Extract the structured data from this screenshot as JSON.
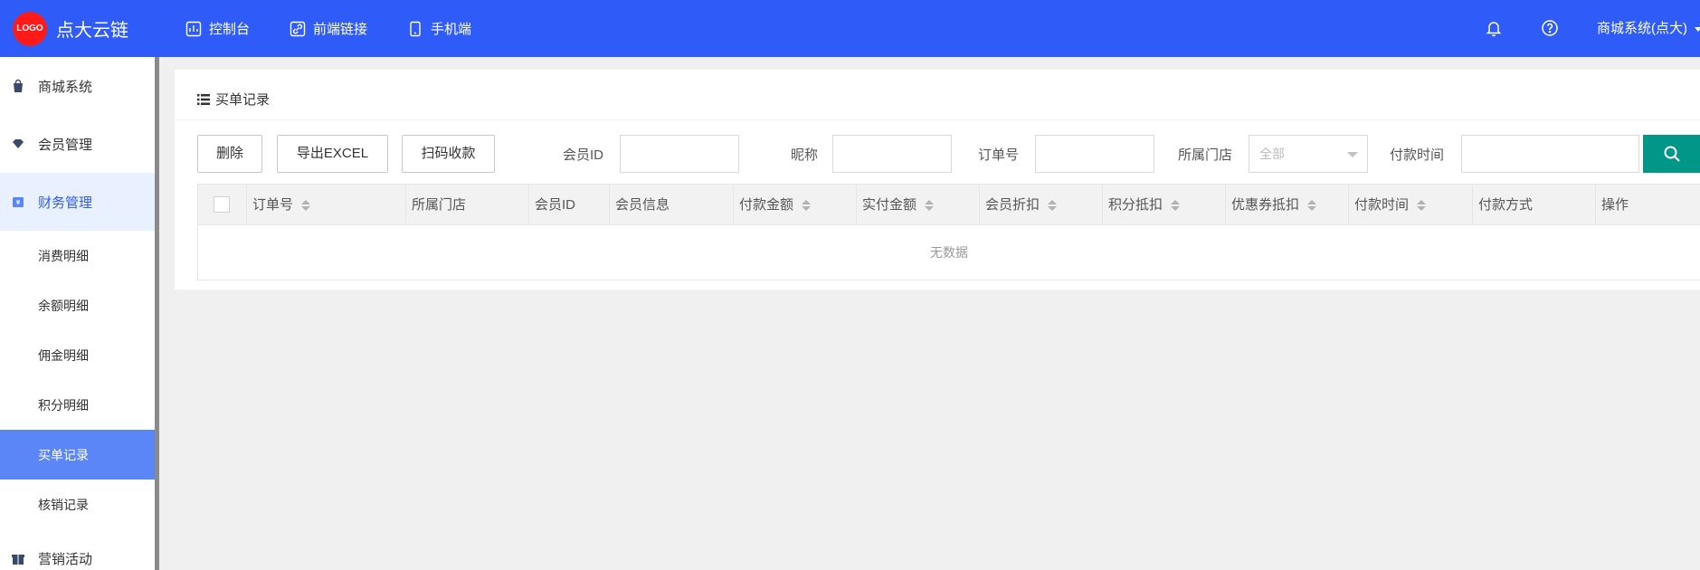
{
  "header": {
    "logo_text": "LOGO",
    "brand": "点大云链",
    "nav": [
      {
        "label": "控制台",
        "icon": "dashboard-icon"
      },
      {
        "label": "前端链接",
        "icon": "link-icon"
      },
      {
        "label": "手机端",
        "icon": "mobile-icon"
      }
    ],
    "user": "商城系统(点大)",
    "colors": {
      "bar": "#2f5cf8",
      "logo": "#ff1a1a"
    }
  },
  "sidebar": {
    "items": [
      {
        "label": "商城系统",
        "icon": "shopping-bag-icon"
      },
      {
        "label": "会员管理",
        "icon": "diamond-icon"
      },
      {
        "label": "财务管理",
        "icon": "wallet-icon"
      }
    ],
    "sub_items": [
      "消费明细",
      "余额明细",
      "佣金明细",
      "积分明细",
      "买单记录",
      "核销记录"
    ],
    "next_item": {
      "label": "营销活动",
      "icon": "gift-icon"
    },
    "current": "买单记录",
    "colors": {
      "active_bg": "#5b86f7"
    }
  },
  "panel": {
    "title": "买单记录",
    "buttons": {
      "delete": "删除",
      "export": "导出EXCEL",
      "scan": "扫码收款"
    },
    "filters": {
      "member_id_label": "会员ID",
      "nickname_label": "昵称",
      "order_no_label": "订单号",
      "store_label": "所属门店",
      "store_value": "全部",
      "pay_time_label": "付款时间"
    },
    "search_color": "#009688"
  },
  "table": {
    "columns": [
      "订单号",
      "所属门店",
      "会员ID",
      "会员信息",
      "付款金额",
      "实付金额",
      "会员折扣",
      "积分抵扣",
      "优惠券抵扣",
      "付款时间",
      "付款方式",
      "操作"
    ],
    "sortable": [
      true,
      false,
      false,
      false,
      true,
      true,
      true,
      true,
      true,
      true,
      false,
      false
    ],
    "rows": [],
    "empty_text": "无数据"
  }
}
